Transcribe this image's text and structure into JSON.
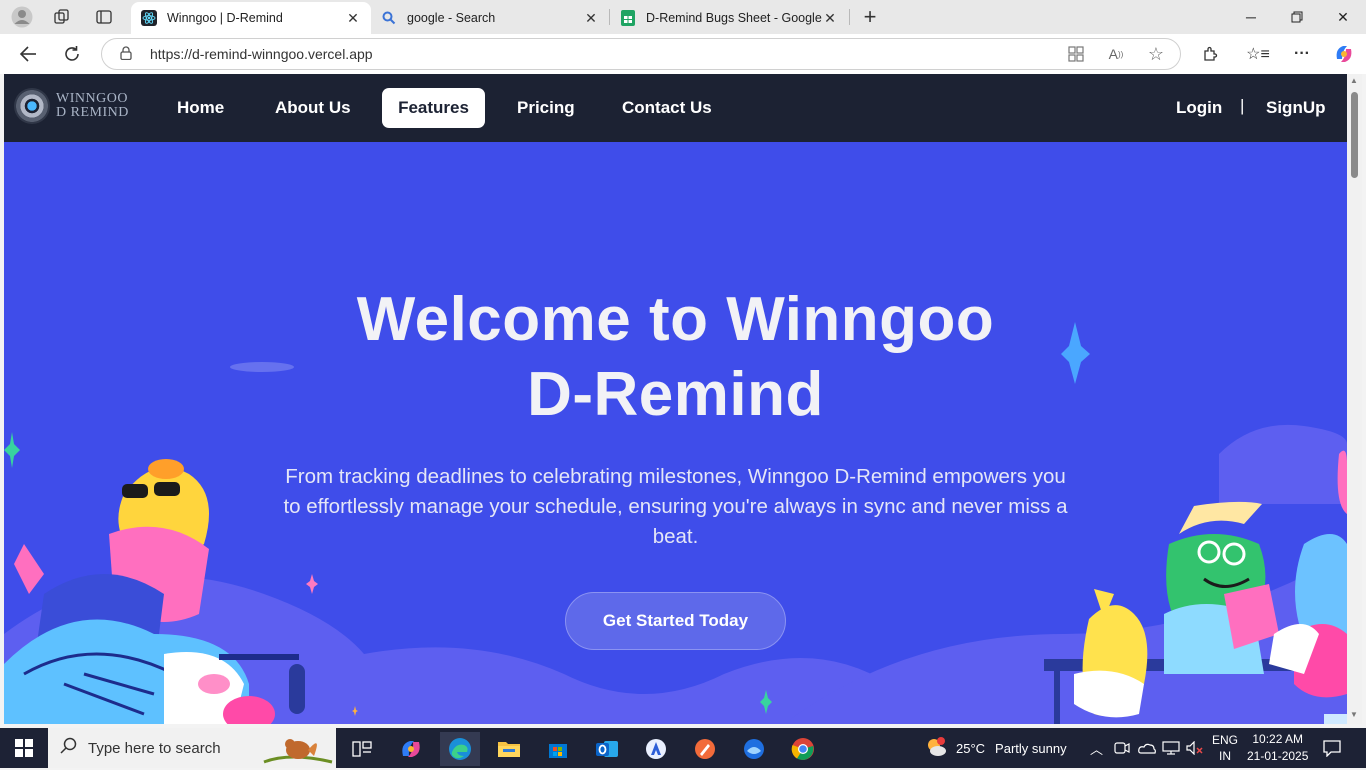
{
  "browser": {
    "tabs": [
      {
        "title": "Winngoo | D-Remind",
        "icon": "react-icon",
        "active": true
      },
      {
        "title": "google - Search",
        "icon": "search-icon",
        "active": false
      },
      {
        "title": "D-Remind Bugs Sheet - Google Sh",
        "icon": "sheets-icon",
        "active": false
      }
    ],
    "url": "https://d-remind-winngoo.vercel.app"
  },
  "site": {
    "logo": {
      "line1": "WINNGOO",
      "line2": "D REMIND"
    },
    "nav": [
      "Home",
      "About Us",
      "Features",
      "Pricing",
      "Contact Us"
    ],
    "active_nav": "Features",
    "auth": {
      "login": "Login",
      "separator": "|",
      "signup": "SignUp"
    }
  },
  "hero": {
    "title_line1": "Welcome to Winngoo",
    "title_line2": "D-Remind",
    "subtitle": "From tracking deadlines to celebrating milestones, Winngoo D-Remind empowers you to effortlessly manage your schedule, ensuring you're always in sync and never miss a beat.",
    "cta": "Get Started Today"
  },
  "taskbar": {
    "search_placeholder": "Type here to search",
    "weather": {
      "temp": "25°C",
      "condition": "Partly sunny"
    },
    "language": {
      "line1": "ENG",
      "line2": "IN"
    },
    "clock": {
      "time": "10:22 AM",
      "date": "21-01-2025"
    }
  },
  "colors": {
    "hero_bg": "#3f4dea",
    "nav_bg": "#1c2233",
    "cta_bg": "#5e69ea",
    "taskbar_bg": "#1d2235"
  }
}
